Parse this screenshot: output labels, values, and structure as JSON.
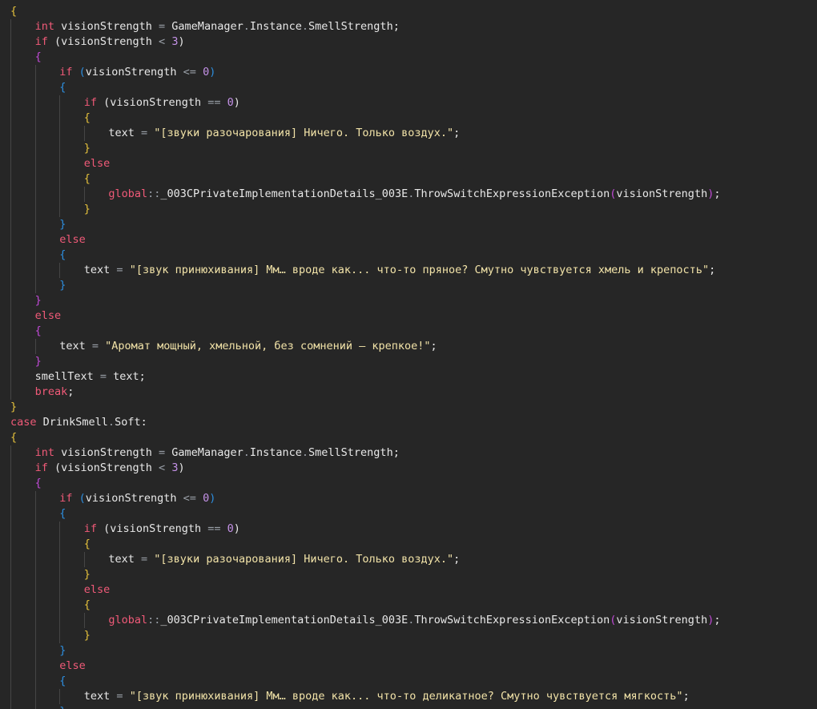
{
  "lines": [
    [
      {
        "t": "{",
        "c": "b1"
      }
    ],
    [
      {
        "i": 1
      },
      {
        "t": "int",
        "c": "kw"
      },
      {
        "t": " visionStrength ",
        "c": "id"
      },
      {
        "t": "=",
        "c": "op"
      },
      {
        "t": " GameManager",
        "c": "cls"
      },
      {
        "t": ".",
        "c": "op"
      },
      {
        "t": "Instance",
        "c": "id"
      },
      {
        "t": ".",
        "c": "op"
      },
      {
        "t": "SmellStrength;",
        "c": "id"
      }
    ],
    [
      {
        "i": 1
      },
      {
        "t": "if",
        "c": "kw"
      },
      {
        "t": " (visionStrength ",
        "c": "id"
      },
      {
        "t": "<",
        "c": "op"
      },
      {
        "t": " ",
        "c": "id"
      },
      {
        "t": "3",
        "c": "num"
      },
      {
        "t": ")",
        "c": "id"
      }
    ],
    [
      {
        "i": 1
      },
      {
        "t": "{",
        "c": "b2"
      }
    ],
    [
      {
        "i": 2
      },
      {
        "t": "if",
        "c": "kw"
      },
      {
        "t": " ",
        "c": "id"
      },
      {
        "t": "(",
        "c": "b3"
      },
      {
        "t": "visionStrength ",
        "c": "id"
      },
      {
        "t": "<=",
        "c": "op"
      },
      {
        "t": " ",
        "c": "id"
      },
      {
        "t": "0",
        "c": "num"
      },
      {
        "t": ")",
        "c": "b3"
      }
    ],
    [
      {
        "i": 2
      },
      {
        "t": "{",
        "c": "b3"
      }
    ],
    [
      {
        "i": 3
      },
      {
        "t": "if",
        "c": "kw"
      },
      {
        "t": " (visionStrength ",
        "c": "id"
      },
      {
        "t": "==",
        "c": "op"
      },
      {
        "t": " ",
        "c": "id"
      },
      {
        "t": "0",
        "c": "num"
      },
      {
        "t": ")",
        "c": "id"
      }
    ],
    [
      {
        "i": 3
      },
      {
        "t": "{",
        "c": "b1"
      }
    ],
    [
      {
        "i": 4
      },
      {
        "t": "text ",
        "c": "id"
      },
      {
        "t": "=",
        "c": "op"
      },
      {
        "t": " ",
        "c": "id"
      },
      {
        "t": "\"[звуки разочарования] Ничего. Только воздух.\"",
        "c": "str"
      },
      {
        "t": ";",
        "c": "id"
      }
    ],
    [
      {
        "i": 3
      },
      {
        "t": "}",
        "c": "b1"
      }
    ],
    [
      {
        "i": 3
      },
      {
        "t": "else",
        "c": "kw"
      }
    ],
    [
      {
        "i": 3
      },
      {
        "t": "{",
        "c": "b1"
      }
    ],
    [
      {
        "i": 4
      },
      {
        "t": "global",
        "c": "kw"
      },
      {
        "t": "::",
        "c": "op"
      },
      {
        "t": "_003CPrivateImplementationDetails_003E",
        "c": "cls"
      },
      {
        "t": ".",
        "c": "op"
      },
      {
        "t": "ThrowSwitchExpressionException",
        "c": "id"
      },
      {
        "t": "(",
        "c": "b2"
      },
      {
        "t": "visionStrength",
        "c": "id"
      },
      {
        "t": ")",
        "c": "b2"
      },
      {
        "t": ";",
        "c": "id"
      }
    ],
    [
      {
        "i": 3
      },
      {
        "t": "}",
        "c": "b1"
      }
    ],
    [
      {
        "i": 2
      },
      {
        "t": "}",
        "c": "b3"
      }
    ],
    [
      {
        "i": 2
      },
      {
        "t": "else",
        "c": "kw"
      }
    ],
    [
      {
        "i": 2
      },
      {
        "t": "{",
        "c": "b3"
      }
    ],
    [
      {
        "i": 3
      },
      {
        "t": "text ",
        "c": "id"
      },
      {
        "t": "=",
        "c": "op"
      },
      {
        "t": " ",
        "c": "id"
      },
      {
        "t": "\"[звук принюхивания] Мм… вроде как... что-то пряное? Смутно чувствуется хмель и крепость\"",
        "c": "str"
      },
      {
        "t": ";",
        "c": "id"
      }
    ],
    [
      {
        "i": 2
      },
      {
        "t": "}",
        "c": "b3"
      }
    ],
    [
      {
        "i": 1
      },
      {
        "t": "}",
        "c": "b2"
      }
    ],
    [
      {
        "i": 1
      },
      {
        "t": "else",
        "c": "kw"
      }
    ],
    [
      {
        "i": 1
      },
      {
        "t": "{",
        "c": "b2"
      }
    ],
    [
      {
        "i": 2
      },
      {
        "t": "text ",
        "c": "id"
      },
      {
        "t": "=",
        "c": "op"
      },
      {
        "t": " ",
        "c": "id"
      },
      {
        "t": "\"Аромат мощный, хмельной, без сомнений — крепкое!\"",
        "c": "str"
      },
      {
        "t": ";",
        "c": "id"
      }
    ],
    [
      {
        "i": 1
      },
      {
        "t": "}",
        "c": "b2"
      }
    ],
    [
      {
        "i": 1
      },
      {
        "t": "smellText ",
        "c": "id"
      },
      {
        "t": "=",
        "c": "op"
      },
      {
        "t": " text;",
        "c": "id"
      }
    ],
    [
      {
        "i": 1
      },
      {
        "t": "break",
        "c": "kw"
      },
      {
        "t": ";",
        "c": "id"
      }
    ],
    [
      {
        "t": "}",
        "c": "b1"
      }
    ],
    [
      {
        "t": "case",
        "c": "kw"
      },
      {
        "t": " DrinkSmell",
        "c": "cls"
      },
      {
        "t": ".",
        "c": "op"
      },
      {
        "t": "Soft:",
        "c": "id"
      }
    ],
    [
      {
        "t": "{",
        "c": "b1"
      }
    ],
    [
      {
        "i": 1
      },
      {
        "t": "int",
        "c": "kw"
      },
      {
        "t": " visionStrength ",
        "c": "id"
      },
      {
        "t": "=",
        "c": "op"
      },
      {
        "t": " GameManager",
        "c": "cls"
      },
      {
        "t": ".",
        "c": "op"
      },
      {
        "t": "Instance",
        "c": "id"
      },
      {
        "t": ".",
        "c": "op"
      },
      {
        "t": "SmellStrength;",
        "c": "id"
      }
    ],
    [
      {
        "i": 1
      },
      {
        "t": "if",
        "c": "kw"
      },
      {
        "t": " (visionStrength ",
        "c": "id"
      },
      {
        "t": "<",
        "c": "op"
      },
      {
        "t": " ",
        "c": "id"
      },
      {
        "t": "3",
        "c": "num"
      },
      {
        "t": ")",
        "c": "id"
      }
    ],
    [
      {
        "i": 1
      },
      {
        "t": "{",
        "c": "b2"
      }
    ],
    [
      {
        "i": 2
      },
      {
        "t": "if",
        "c": "kw"
      },
      {
        "t": " ",
        "c": "id"
      },
      {
        "t": "(",
        "c": "b3"
      },
      {
        "t": "visionStrength ",
        "c": "id"
      },
      {
        "t": "<=",
        "c": "op"
      },
      {
        "t": " ",
        "c": "id"
      },
      {
        "t": "0",
        "c": "num"
      },
      {
        "t": ")",
        "c": "b3"
      }
    ],
    [
      {
        "i": 2
      },
      {
        "t": "{",
        "c": "b3"
      }
    ],
    [
      {
        "i": 3
      },
      {
        "t": "if",
        "c": "kw"
      },
      {
        "t": " (visionStrength ",
        "c": "id"
      },
      {
        "t": "==",
        "c": "op"
      },
      {
        "t": " ",
        "c": "id"
      },
      {
        "t": "0",
        "c": "num"
      },
      {
        "t": ")",
        "c": "id"
      }
    ],
    [
      {
        "i": 3
      },
      {
        "t": "{",
        "c": "b1"
      }
    ],
    [
      {
        "i": 4
      },
      {
        "t": "text ",
        "c": "id"
      },
      {
        "t": "=",
        "c": "op"
      },
      {
        "t": " ",
        "c": "id"
      },
      {
        "t": "\"[звуки разочарования] Ничего. Только воздух.\"",
        "c": "str"
      },
      {
        "t": ";",
        "c": "id"
      }
    ],
    [
      {
        "i": 3
      },
      {
        "t": "}",
        "c": "b1"
      }
    ],
    [
      {
        "i": 3
      },
      {
        "t": "else",
        "c": "kw"
      }
    ],
    [
      {
        "i": 3
      },
      {
        "t": "{",
        "c": "b1"
      }
    ],
    [
      {
        "i": 4
      },
      {
        "t": "global",
        "c": "kw"
      },
      {
        "t": "::",
        "c": "op"
      },
      {
        "t": "_003CPrivateImplementationDetails_003E",
        "c": "cls"
      },
      {
        "t": ".",
        "c": "op"
      },
      {
        "t": "ThrowSwitchExpressionException",
        "c": "id"
      },
      {
        "t": "(",
        "c": "b2"
      },
      {
        "t": "visionStrength",
        "c": "id"
      },
      {
        "t": ")",
        "c": "b2"
      },
      {
        "t": ";",
        "c": "id"
      }
    ],
    [
      {
        "i": 3
      },
      {
        "t": "}",
        "c": "b1"
      }
    ],
    [
      {
        "i": 2
      },
      {
        "t": "}",
        "c": "b3"
      }
    ],
    [
      {
        "i": 2
      },
      {
        "t": "else",
        "c": "kw"
      }
    ],
    [
      {
        "i": 2
      },
      {
        "t": "{",
        "c": "b3"
      }
    ],
    [
      {
        "i": 3
      },
      {
        "t": "text ",
        "c": "id"
      },
      {
        "t": "=",
        "c": "op"
      },
      {
        "t": " ",
        "c": "id"
      },
      {
        "t": "\"[звук принюхивания] Мм… вроде как... что-то деликатное? Смутно чувствуется мягкость\"",
        "c": "str"
      },
      {
        "t": ";",
        "c": "id"
      }
    ],
    [
      {
        "i": 2
      },
      {
        "t": "}",
        "c": "b3"
      }
    ]
  ],
  "colors": {
    "background": "#262626",
    "keyword": "#f05a78",
    "identifier": "#e8e8e8",
    "operator": "#9aa0a8",
    "number": "#c592e8",
    "string": "#f2e3a8",
    "bracket_level1": "#e6c23c",
    "bracket_level2": "#c04ad6",
    "bracket_level3": "#2d8fe0",
    "indent_guide": "#454545"
  }
}
